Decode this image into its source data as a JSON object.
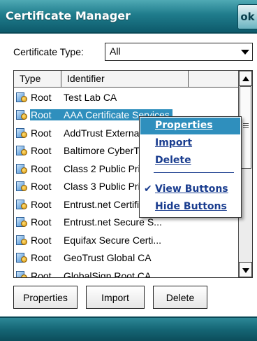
{
  "window": {
    "title": "Certificate Manager",
    "ok_label": "ok"
  },
  "certificate_type": {
    "label": "Certificate Type:",
    "selected": "All"
  },
  "list": {
    "columns": [
      "Type",
      "Identifier",
      ""
    ],
    "rows": [
      {
        "type": "Root",
        "identifier": "Test Lab CA",
        "selected": false
      },
      {
        "type": "Root",
        "identifier": "AAA Certificate Services",
        "selected": true
      },
      {
        "type": "Root",
        "identifier": "AddTrust External CA Root",
        "selected": false
      },
      {
        "type": "Root",
        "identifier": "Baltimore CyberTrust Root",
        "selected": false
      },
      {
        "type": "Root",
        "identifier": "Class 2 Public Primary",
        "selected": false
      },
      {
        "type": "Root",
        "identifier": "Class 3 Public Primary",
        "selected": false
      },
      {
        "type": "Root",
        "identifier": "Entrust.net Certification",
        "selected": false
      },
      {
        "type": "Root",
        "identifier": "Entrust.net Secure S...",
        "selected": false
      },
      {
        "type": "Root",
        "identifier": "Equifax Secure Certi...",
        "selected": false
      },
      {
        "type": "Root",
        "identifier": "GeoTrust Global CA",
        "selected": false
      },
      {
        "type": "Root",
        "identifier": "GlobalSign Root CA",
        "selected": false
      }
    ]
  },
  "context_menu": {
    "properties": "Properties",
    "import": "Import",
    "delete": "Delete",
    "view_buttons": "View Buttons",
    "hide_buttons": "Hide Buttons",
    "checkmark": "✔"
  },
  "buttons": {
    "properties": "Properties",
    "import": "Import",
    "delete": "Delete"
  },
  "colors": {
    "title_bar": "#1f7c8c",
    "selection": "#2f8fbd",
    "menu_text": "#1a3d8f"
  }
}
